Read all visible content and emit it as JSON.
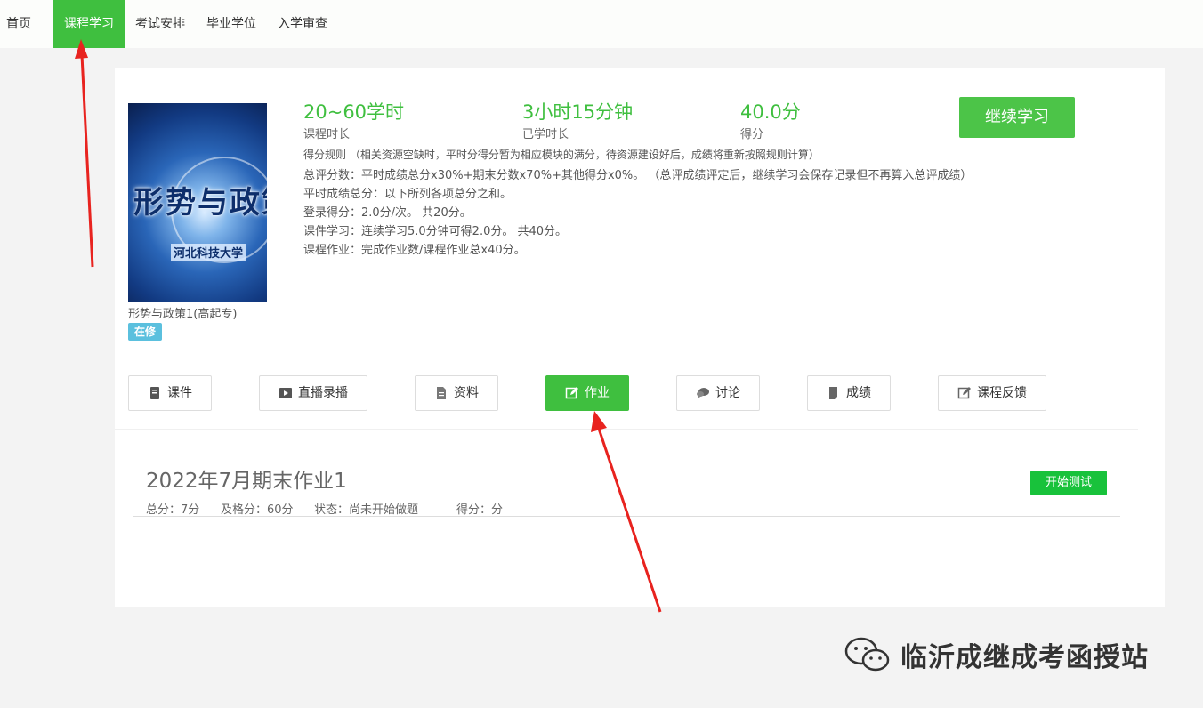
{
  "nav": {
    "items": [
      {
        "label": "首页",
        "active": false
      },
      {
        "label": "课程学习",
        "active": true
      },
      {
        "label": "考试安排",
        "active": false
      },
      {
        "label": "毕业学位",
        "active": false
      },
      {
        "label": "入学审查",
        "active": false
      }
    ]
  },
  "course": {
    "cover_title": "形势与政策",
    "cover_school": "河北科技大学",
    "name": "形势与政策1(高起专)",
    "status": "在修",
    "stats": [
      {
        "value": "20~60学时",
        "label": "课程时长"
      },
      {
        "value": "3小时15分钟",
        "label": "已学时长"
      },
      {
        "value": "40.0分",
        "label": "得分"
      }
    ],
    "continue_label": "继续学习",
    "rules": [
      "得分规则 （相关资源空缺时，平时分得分暂为相应模块的满分，待资源建设好后，成绩将重新按照规则计算）",
      "总评分数：平时成绩总分x30%+期末分数x70%+其他得分x0%。  （总评成绩评定后，继续学习会保存记录但不再算入总评成绩）",
      "平时成绩总分：以下所列各项总分之和。",
      "登录得分：2.0分/次。 共20分。",
      "课件学习：连续学习5.0分钟可得2.0分。 共40分。",
      "课程作业：完成作业数/课程作业总x40分。"
    ]
  },
  "tabs": [
    {
      "label": "课件",
      "icon": "book-icon"
    },
    {
      "label": "直播录播",
      "icon": "video-icon"
    },
    {
      "label": "资料",
      "icon": "document-icon"
    },
    {
      "label": "作业",
      "icon": "edit-icon",
      "active": true
    },
    {
      "label": "讨论",
      "icon": "chat-icon"
    },
    {
      "label": "成绩",
      "icon": "grade-icon"
    },
    {
      "label": "课程反馈",
      "icon": "feedback-icon"
    }
  ],
  "homework": {
    "title": "2022年7月期末作业1",
    "total": "总分：7分",
    "pass": "及格分：60分",
    "status": "状态：尚未开始做题",
    "score": "得分：分",
    "start_label": "开始测试"
  },
  "watermark": {
    "text": "临沂成继成考函授站",
    "icon": "wechat-icon"
  },
  "colors": {
    "accent": "#3fbf3f",
    "badge": "#5bc0de",
    "start_button": "#18c23b",
    "arrow": "#e8231f"
  }
}
